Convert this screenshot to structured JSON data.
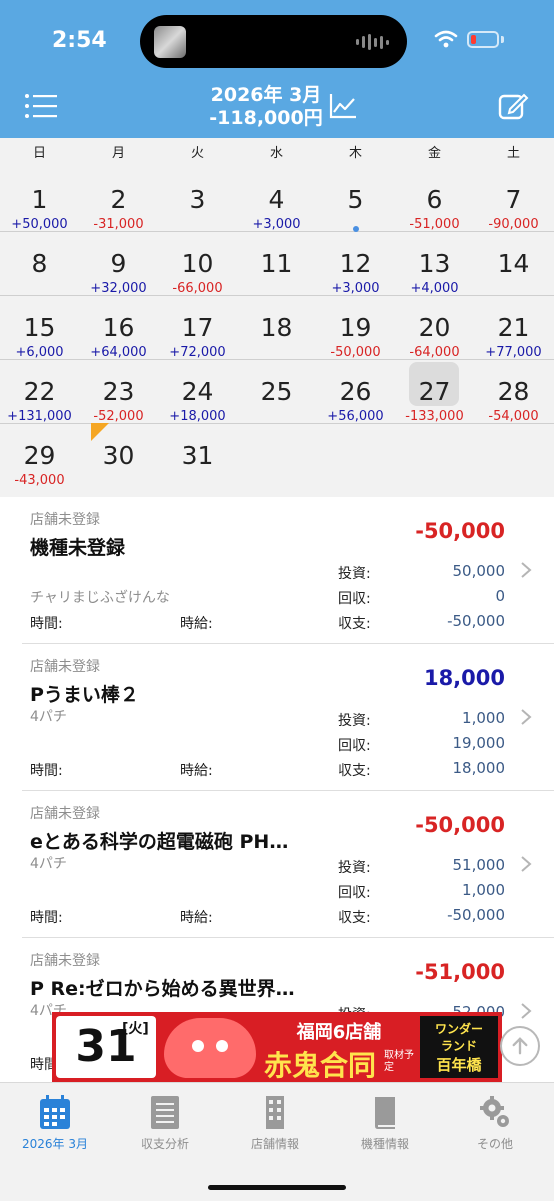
{
  "status_bar": {
    "time": "2:54"
  },
  "header": {
    "month_line1": "2026年 3月",
    "month_line2": "-118,000円"
  },
  "weekdays": [
    "日",
    "月",
    "火",
    "水",
    "木",
    "金",
    "土"
  ],
  "calendar": {
    "days": [
      {
        "day": "1",
        "amount": "+50,000",
        "sign": "pos"
      },
      {
        "day": "2",
        "amount": "-31,000",
        "sign": "neg"
      },
      {
        "day": "3",
        "amount": "",
        "sign": ""
      },
      {
        "day": "4",
        "amount": "+3,000",
        "sign": "pos"
      },
      {
        "day": "5",
        "amount": "",
        "sign": ""
      },
      {
        "day": "6",
        "amount": "-51,000",
        "sign": "neg"
      },
      {
        "day": "7",
        "amount": "-90,000",
        "sign": "neg"
      },
      {
        "day": "8",
        "amount": "",
        "sign": ""
      },
      {
        "day": "9",
        "amount": "+32,000",
        "sign": "pos"
      },
      {
        "day": "10",
        "amount": "-66,000",
        "sign": "neg"
      },
      {
        "day": "11",
        "amount": "",
        "sign": ""
      },
      {
        "day": "12",
        "amount": "+3,000",
        "sign": "pos",
        "dot": true
      },
      {
        "day": "13",
        "amount": "+4,000",
        "sign": "pos"
      },
      {
        "day": "14",
        "amount": "",
        "sign": ""
      },
      {
        "day": "15",
        "amount": "+6,000",
        "sign": "pos"
      },
      {
        "day": "16",
        "amount": "+64,000",
        "sign": "pos"
      },
      {
        "day": "17",
        "amount": "+72,000",
        "sign": "pos"
      },
      {
        "day": "18",
        "amount": "",
        "sign": ""
      },
      {
        "day": "19",
        "amount": "-50,000",
        "sign": "neg"
      },
      {
        "day": "20",
        "amount": "-64,000",
        "sign": "neg"
      },
      {
        "day": "21",
        "amount": "+77,000",
        "sign": "pos"
      },
      {
        "day": "22",
        "amount": "+131,000",
        "sign": "pos"
      },
      {
        "day": "23",
        "amount": "-52,000",
        "sign": "neg"
      },
      {
        "day": "24",
        "amount": "+18,000",
        "sign": "pos"
      },
      {
        "day": "25",
        "amount": "",
        "sign": ""
      },
      {
        "day": "26",
        "amount": "+56,000",
        "sign": "pos"
      },
      {
        "day": "27",
        "amount": "-133,000",
        "sign": "neg",
        "today": true
      },
      {
        "day": "28",
        "amount": "-54,000",
        "sign": "neg"
      },
      {
        "day": "29",
        "amount": "-43,000",
        "sign": "neg"
      },
      {
        "day": "30",
        "amount": "",
        "sign": "",
        "marker": true
      },
      {
        "day": "31",
        "amount": "",
        "sign": ""
      }
    ]
  },
  "labels": {
    "invest": "投資:",
    "collect": "回収:",
    "balance": "収支:",
    "time": "時間:",
    "wage": "時給:"
  },
  "entries": [
    {
      "shop": "店舗未登録",
      "machine": "機種未登録",
      "total": "-50,000",
      "sign": "neg",
      "sub": "チャリまじふざけんな",
      "invest": "50,000",
      "collect": "0",
      "balance": "-50,000"
    },
    {
      "shop": "店舗未登録",
      "machine": "Pうまい棒２",
      "total": "18,000",
      "sign": "pos",
      "sub": "4パチ",
      "invest": "1,000",
      "collect": "19,000",
      "balance": "18,000"
    },
    {
      "shop": "店舗未登録",
      "machine": "eとある科学の超電磁砲 PH…",
      "total": "-50,000",
      "sign": "neg",
      "sub": "4パチ",
      "invest": "51,000",
      "collect": "1,000",
      "balance": "-50,000"
    },
    {
      "shop": "店舗未登録",
      "machine": "P Re:ゼロから始める異世界…",
      "total": "-51,000",
      "sign": "neg",
      "sub": "4パチ",
      "invest": "52,000",
      "collect": "",
      "balance": ""
    }
  ],
  "ad": {
    "day": "31日",
    "dow": "[火]",
    "line1": "福岡6店舗",
    "line2": "赤鬼合同",
    "line3": "取材予定",
    "right1": "ワンダー",
    "right2": "ランド",
    "right3": "百年橋"
  },
  "tabs": [
    {
      "label": "2026年 3月",
      "icon": "calendar-icon",
      "active": true
    },
    {
      "label": "収支分析",
      "icon": "notepad-icon"
    },
    {
      "label": "店舗情報",
      "icon": "building-icon"
    },
    {
      "label": "機種情報",
      "icon": "book-icon"
    },
    {
      "label": "その他",
      "icon": "gear-icon"
    }
  ],
  "colors": {
    "header": "#5aa8e2",
    "positive": "#1a1aa8",
    "negative": "#d82424",
    "tab_active": "#2a82d8"
  }
}
